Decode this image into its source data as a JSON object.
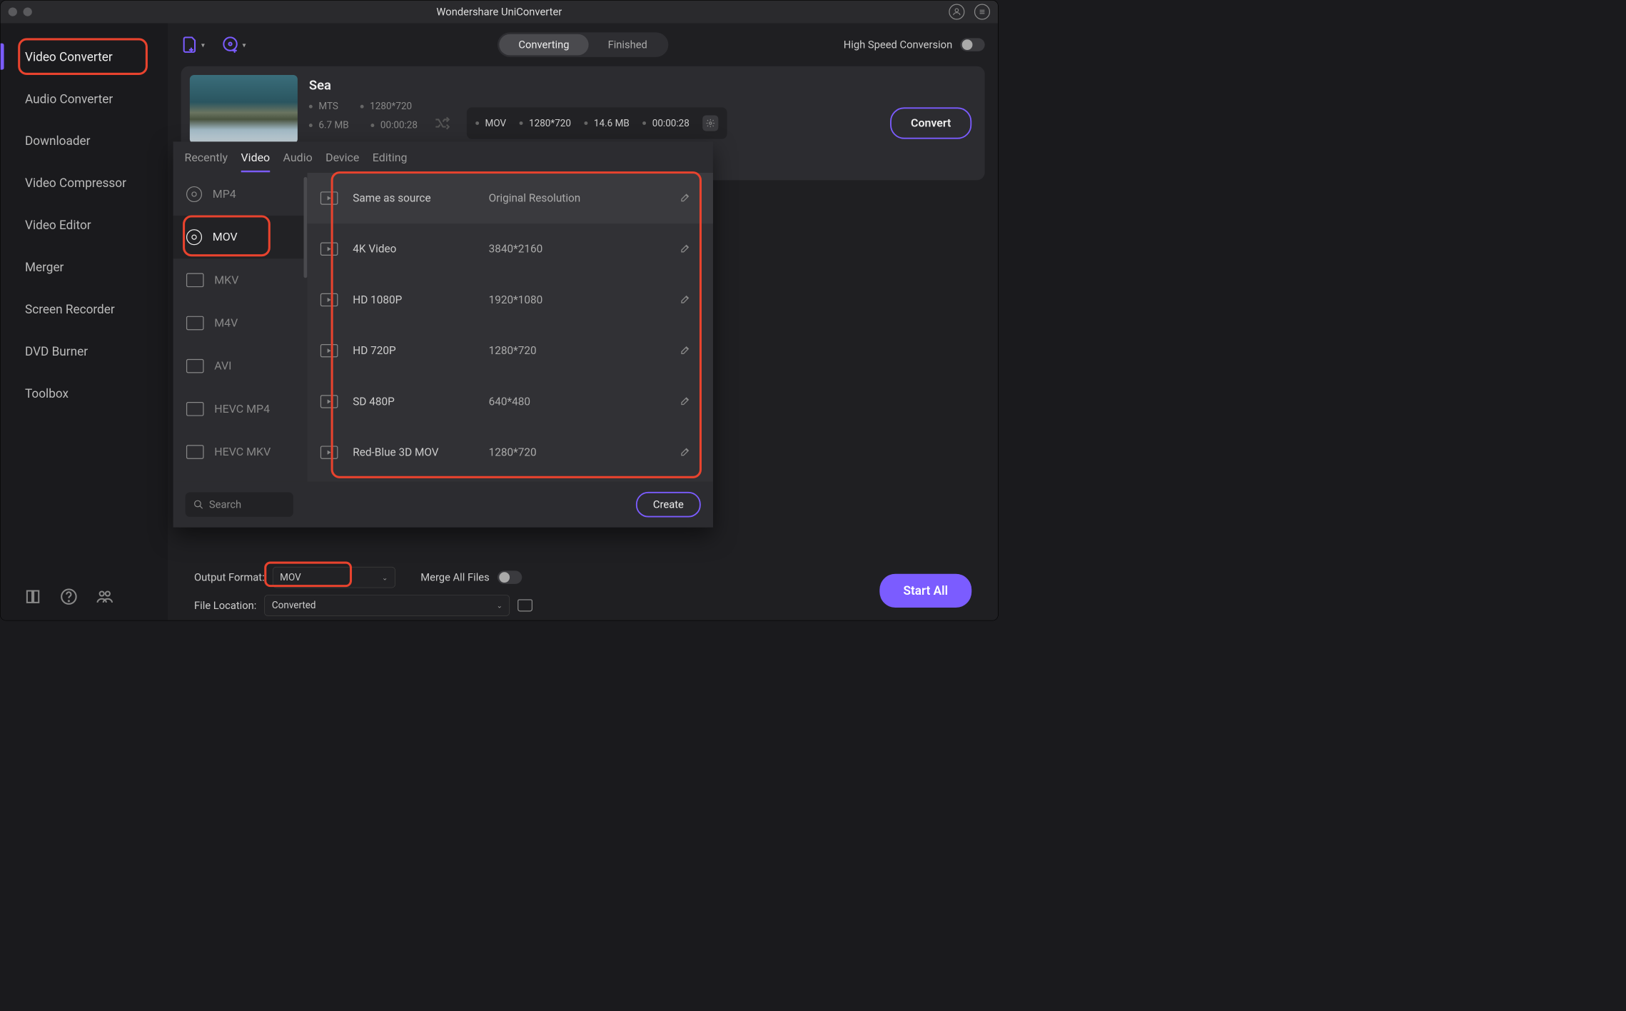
{
  "title": "Wondershare UniConverter",
  "sidebar": {
    "items": [
      "Video Converter",
      "Audio Converter",
      "Downloader",
      "Video Compressor",
      "Video Editor",
      "Merger",
      "Screen Recorder",
      "DVD Burner",
      "Toolbox"
    ],
    "active_index": 0
  },
  "toolbar": {
    "tabs": [
      "Converting",
      "Finished"
    ],
    "active_tab": 0,
    "high_speed_label": "High Speed Conversion"
  },
  "file": {
    "name": "Sea",
    "src": {
      "format": "MTS",
      "resolution": "1280*720",
      "size": "6.7 MB",
      "duration": "00:00:28"
    },
    "dst": {
      "format": "MOV",
      "resolution": "1280*720",
      "size": "14.6 MB",
      "duration": "00:00:28"
    },
    "convert_label": "Convert"
  },
  "dropdown": {
    "tabs": [
      "Recently",
      "Video",
      "Audio",
      "Device",
      "Editing"
    ],
    "active_tab": 1,
    "formats": [
      "MP4",
      "MOV",
      "MKV",
      "M4V",
      "AVI",
      "HEVC MP4",
      "HEVC MKV"
    ],
    "active_format": 1,
    "resolutions": [
      {
        "name": "Same as source",
        "value": "Original Resolution"
      },
      {
        "name": "4K Video",
        "value": "3840*2160"
      },
      {
        "name": "HD 1080P",
        "value": "1920*1080"
      },
      {
        "name": "HD 720P",
        "value": "1280*720"
      },
      {
        "name": "SD 480P",
        "value": "640*480"
      },
      {
        "name": "Red-Blue 3D MOV",
        "value": "1280*720"
      }
    ],
    "search_placeholder": "Search",
    "create_label": "Create"
  },
  "bottom": {
    "output_format_label": "Output Format:",
    "output_format_value": "MOV",
    "merge_label": "Merge All Files",
    "file_location_label": "File Location:",
    "file_location_value": "Converted",
    "start_all_label": "Start All"
  }
}
